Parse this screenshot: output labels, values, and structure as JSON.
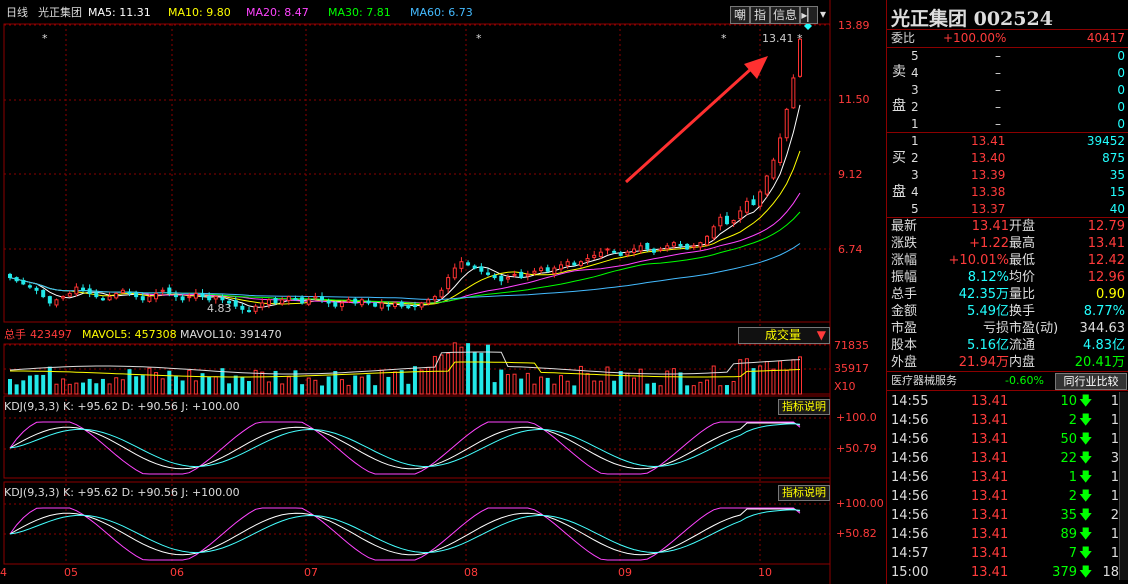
{
  "header": {
    "period": "日线",
    "name": "光正集团",
    "ma": [
      {
        "label": "MA5: 11.31",
        "color": "#ffffff"
      },
      {
        "label": "MA10: 9.80",
        "color": "#ffff00"
      },
      {
        "label": "MA20: 8.47",
        "color": "#ff44ff"
      },
      {
        "label": "MA30: 7.81",
        "color": "#00ff00"
      },
      {
        "label": "MA60: 6.73",
        "color": "#44bbff"
      }
    ],
    "buttons": [
      "嘲",
      "指",
      "信息"
    ]
  },
  "price_axis": [
    "13.89",
    "11.50",
    "9.12",
    "6.74"
  ],
  "annotations": {
    "high": "13.41",
    "low": "4.83",
    "stars": [
      "*",
      "*",
      "*",
      "*"
    ]
  },
  "volume": {
    "label": "总手",
    "value": "423497",
    "mavol5": "MAVOL5: 457308",
    "mavol10": "MAVOL10: 391470",
    "dropdown": "成交量",
    "axis": [
      "71835",
      "35917",
      "X10"
    ]
  },
  "kdj1": {
    "label": "KDJ(9,3,3) K: +95.62 D: +90.56 J: +100.00",
    "btn": "指标说明",
    "axis": [
      "+100.0",
      "+50.79"
    ]
  },
  "kdj2": {
    "label": "KDJ(9,3,3) K: +95.62 D: +90.56 J: +100.00",
    "btn": "指标说明",
    "axis": [
      "+100.00",
      "+50.82"
    ]
  },
  "months": [
    "4",
    "05",
    "06",
    "07",
    "08",
    "09",
    "10"
  ],
  "colors": {
    "up": "#ff3333",
    "down": "#22e8e8",
    "grid": "#8b0000",
    "ma5": "#ffffff",
    "ma10": "#ffff00",
    "ma20": "#ff44ff",
    "ma30": "#00ff00",
    "ma60": "#44bbff"
  },
  "chart_data": {
    "type": "candlestick",
    "price_ylim": [
      4.5,
      13.89
    ],
    "months": [
      "05",
      "06",
      "07",
      "08",
      "09",
      "10"
    ],
    "close_series": [
      5.9,
      5.8,
      5.7,
      5.6,
      5.5,
      5.3,
      5.1,
      5.2,
      5.3,
      5.4,
      5.6,
      5.5,
      5.4,
      5.3,
      5.2,
      5.3,
      5.4,
      5.5,
      5.4,
      5.3,
      5.2,
      5.3,
      5.4,
      5.5,
      5.4,
      5.3,
      5.2,
      5.3,
      5.4,
      5.3,
      5.2,
      5.3,
      5.2,
      5.1,
      5.0,
      4.9,
      4.83,
      5.0,
      5.1,
      5.2,
      5.1,
      5.2,
      5.3,
      5.2,
      5.1,
      5.2,
      5.3,
      5.2,
      5.1,
      5.0,
      5.1,
      5.2,
      5.1,
      5.2,
      5.1,
      5.0,
      5.1,
      5.0,
      5.1,
      5.0,
      4.95,
      5.0,
      5.1,
      5.2,
      5.3,
      5.5,
      5.9,
      6.2,
      6.4,
      6.3,
      6.2,
      6.1,
      6.0,
      5.9,
      5.8,
      5.9,
      6.0,
      5.9,
      6.0,
      6.1,
      6.2,
      6.1,
      6.2,
      6.3,
      6.4,
      6.3,
      6.4,
      6.5,
      6.6,
      6.7,
      6.8,
      6.7,
      6.6,
      6.7,
      6.8,
      6.9,
      6.8,
      6.7,
      6.8,
      6.9,
      7.0,
      6.9,
      6.8,
      6.9,
      7.0,
      7.2,
      7.5,
      7.8,
      7.6,
      7.7,
      8.0,
      8.3,
      8.2,
      8.6,
      9.1,
      9.6,
      10.3,
      11.2,
      12.19,
      13.41
    ],
    "volume_axis": [
      "71835",
      "35917",
      "X10"
    ],
    "kdj": {
      "K": 95.62,
      "D": 90.56,
      "J": 100.0
    }
  },
  "panel": {
    "title": "光正集团 002524",
    "weibi": {
      "label": "委比",
      "pct": "+100.00%",
      "val": "40417"
    },
    "sell_label": [
      "卖",
      "盘"
    ],
    "buy_label": [
      "买",
      "盘"
    ],
    "sell": [
      {
        "n": "5",
        "p": "–",
        "v": "0"
      },
      {
        "n": "4",
        "p": "–",
        "v": "0"
      },
      {
        "n": "3",
        "p": "–",
        "v": "0"
      },
      {
        "n": "2",
        "p": "–",
        "v": "0"
      },
      {
        "n": "1",
        "p": "–",
        "v": "0"
      }
    ],
    "buy": [
      {
        "n": "1",
        "p": "13.41",
        "v": "39452"
      },
      {
        "n": "2",
        "p": "13.40",
        "v": "875"
      },
      {
        "n": "3",
        "p": "13.39",
        "v": "35"
      },
      {
        "n": "4",
        "p": "13.38",
        "v": "15"
      },
      {
        "n": "5",
        "p": "13.37",
        "v": "40"
      }
    ],
    "stats": [
      {
        "l1": "最新",
        "v1": "13.41",
        "c1": "red",
        "l2": "开盘",
        "v2": "12.79",
        "c2": "red"
      },
      {
        "l1": "涨跌",
        "v1": "+1.22",
        "c1": "red",
        "l2": "最高",
        "v2": "13.41",
        "c2": "red"
      },
      {
        "l1": "涨幅",
        "v1": "+10.01%",
        "c1": "red",
        "l2": "最低",
        "v2": "12.42",
        "c2": "red"
      },
      {
        "l1": "振幅",
        "v1": "8.12%",
        "c1": "cyan",
        "l2": "均价",
        "v2": "12.96",
        "c2": "red"
      },
      {
        "l1": "总手",
        "v1": "42.35万",
        "c1": "cyan",
        "l2": "量比",
        "v2": "0.90",
        "c2": "yel"
      },
      {
        "l1": "金额",
        "v1": "5.49亿",
        "c1": "cyan",
        "l2": "换手",
        "v2": "8.77%",
        "c2": "cyan"
      },
      {
        "l1": "市盈",
        "v1": "亏损",
        "c1": "wht",
        "l2": "市盈(动)",
        "v2": "344.63",
        "c2": "wht"
      },
      {
        "l1": "股本",
        "v1": "5.16亿",
        "c1": "cyan",
        "l2": "流通",
        "v2": "4.83亿",
        "c2": "cyan"
      },
      {
        "l1": "外盘",
        "v1": "21.94万",
        "c1": "red",
        "l2": "内盘",
        "v2": "20.41万",
        "c2": "grn"
      }
    ],
    "industry": {
      "name": "医疗器械服务",
      "pct": "-0.60%",
      "btn": "同行业比较"
    },
    "ticks": [
      {
        "t": "14:55",
        "p": "13.41",
        "v": "10",
        "e": "1"
      },
      {
        "t": "14:56",
        "p": "13.41",
        "v": "2",
        "e": "1"
      },
      {
        "t": "14:56",
        "p": "13.41",
        "v": "50",
        "e": "1"
      },
      {
        "t": "14:56",
        "p": "13.41",
        "v": "22",
        "e": "3"
      },
      {
        "t": "14:56",
        "p": "13.41",
        "v": "1",
        "e": "1"
      },
      {
        "t": "14:56",
        "p": "13.41",
        "v": "2",
        "e": "1"
      },
      {
        "t": "14:56",
        "p": "13.41",
        "v": "35",
        "e": "2"
      },
      {
        "t": "14:56",
        "p": "13.41",
        "v": "89",
        "e": "1"
      },
      {
        "t": "14:57",
        "p": "13.41",
        "v": "7",
        "e": "1"
      },
      {
        "t": "15:00",
        "p": "13.41",
        "v": "379",
        "e": "18"
      }
    ]
  }
}
